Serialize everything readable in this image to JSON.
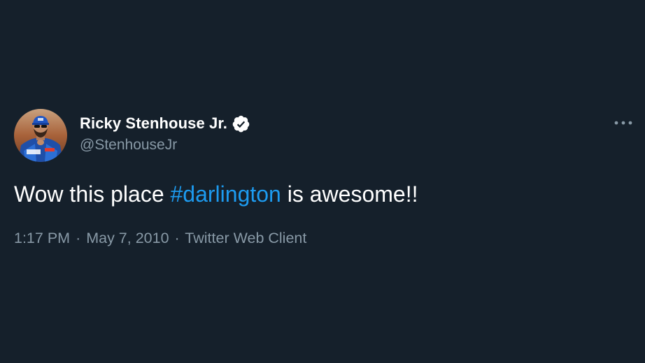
{
  "tweet": {
    "author": {
      "display_name": "Ricky Stenhouse Jr.",
      "handle": "@StenhouseJr",
      "verified": true,
      "avatar_icon": "driver-avatar"
    },
    "text_before": "Wow this place ",
    "hashtag": "#darlington",
    "text_after": " is awesome!!",
    "time": "1:17 PM",
    "separator": "·",
    "date": "May 7, 2010",
    "source": "Twitter Web Client",
    "more_icon": "more-horizontal-icon"
  },
  "colors": {
    "background": "#15202b",
    "primary_text": "#ffffff",
    "secondary_text": "#8899a6",
    "link": "#1d9bf0"
  }
}
